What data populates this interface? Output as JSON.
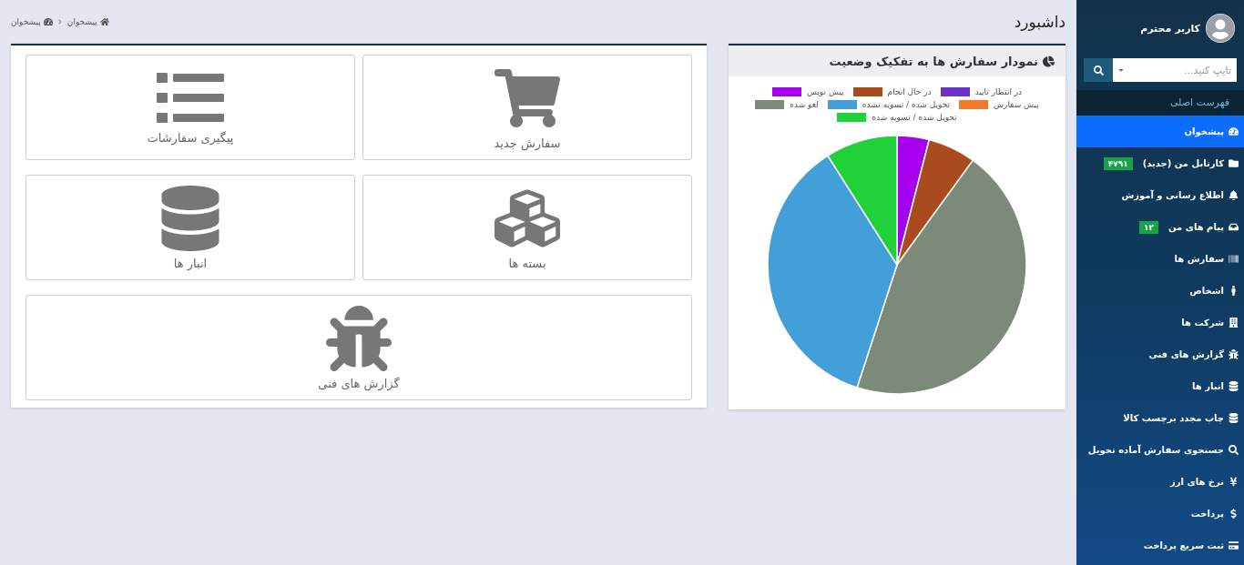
{
  "sidebar": {
    "user": {
      "name": "کاربر محترم"
    },
    "search": {
      "placeholder": "تایپ کنید..."
    },
    "menu_header": "فهرست اصلی",
    "items": [
      {
        "label": "پیشخوان",
        "selected": true
      },
      {
        "label": "کارتابل من (جدید)",
        "selected": false,
        "badge": "۴۷۹۱"
      },
      {
        "label": "اطلاع رسانی و آموزش",
        "selected": false
      },
      {
        "label": "پیام های من",
        "selected": false,
        "badge": "۱۲"
      },
      {
        "label": "سفارش ها",
        "selected": false
      },
      {
        "label": "اشخاص",
        "selected": false
      },
      {
        "label": "شرکت ها",
        "selected": false
      },
      {
        "label": "گزارش های فنی",
        "selected": false
      },
      {
        "label": "انبار ها",
        "selected": false
      },
      {
        "label": "چاپ مجدد برچسب کالا",
        "selected": false
      },
      {
        "label": "جستجوی سفارش آماده تحویل",
        "selected": false
      },
      {
        "label": "نرخ های ارز",
        "selected": false
      },
      {
        "label": "پرداخت",
        "selected": false
      },
      {
        "label": "ثبت سریع پرداخت",
        "selected": false
      }
    ]
  },
  "page": {
    "title": "داشبورد",
    "breadcrumb": [
      "پیشخوان",
      "پیشخوان"
    ]
  },
  "chart": {
    "title": "نمودار سفارش ها به تفکیک وضعیت",
    "legend": [
      {
        "label": "در انتظار تایید",
        "color": "#6a30c8"
      },
      {
        "label": "در حال انجام",
        "color": "#a94a1f"
      },
      {
        "label": "پیش نویس",
        "color": "#a700ee"
      },
      {
        "label": "پیش سفارش",
        "color": "#f07b2c"
      },
      {
        "label": "تحویل شده / تسویه نشده",
        "color": "#439fd8"
      },
      {
        "label": "لغو شده",
        "color": "#7c8a7a"
      },
      {
        "label": "تحویل شده / تسویه شده",
        "color": "#22d13a"
      }
    ]
  },
  "tiles": [
    {
      "label": "سفارش جدید"
    },
    {
      "label": "پیگیری سفارشات"
    },
    {
      "label": "بسته ها"
    },
    {
      "label": "انبار ها"
    },
    {
      "label": "گزارش های فنی"
    }
  ]
}
